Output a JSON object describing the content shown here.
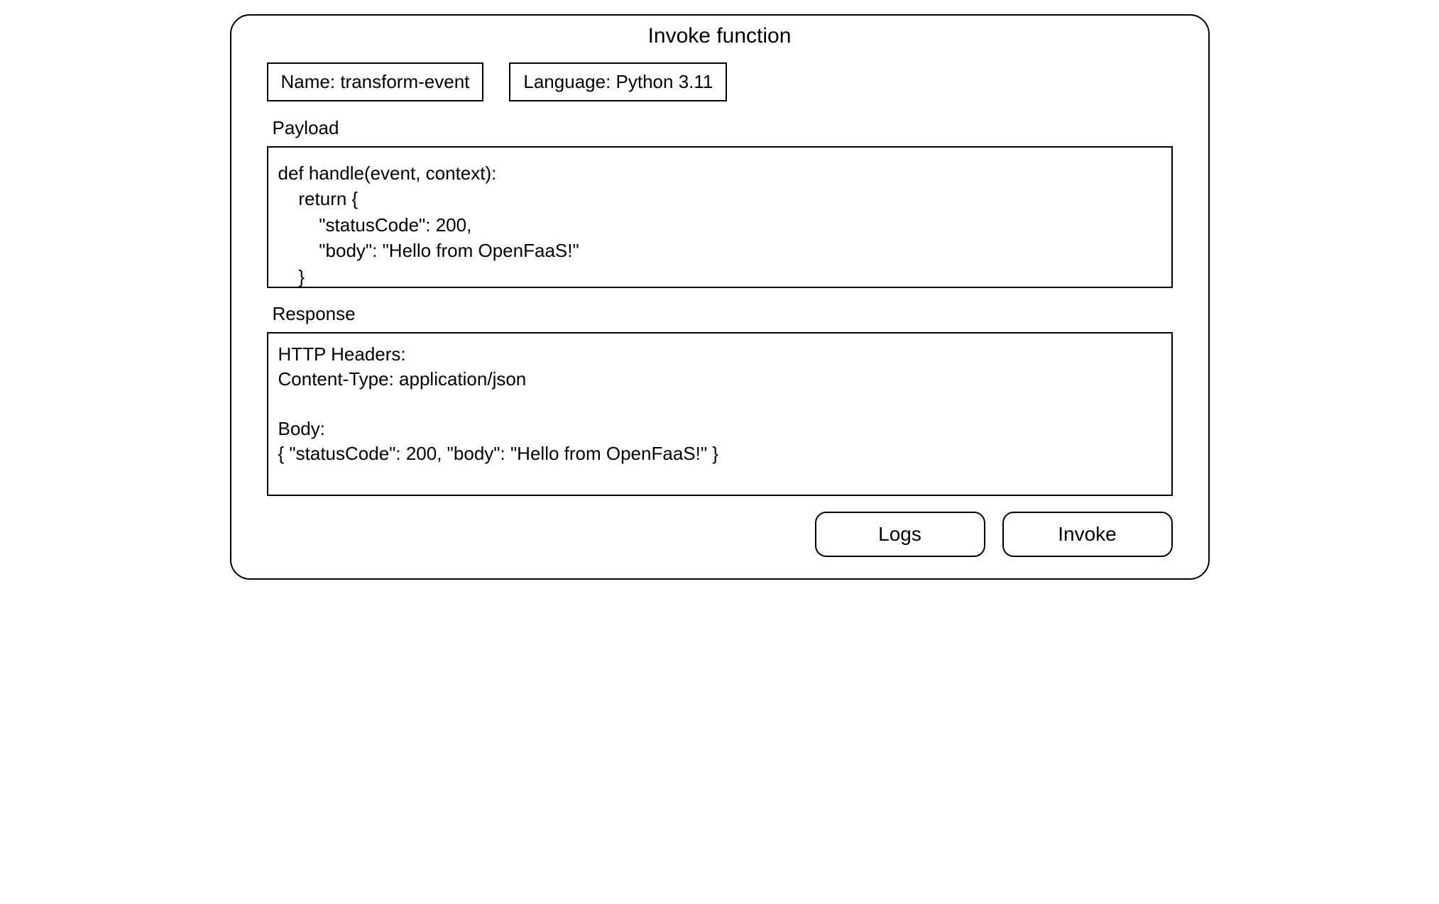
{
  "title": "Invoke function",
  "meta": {
    "name_label": "Name:",
    "name_value": "transform-event",
    "language_label": "Language:",
    "language_value": "Python 3.11"
  },
  "payload": {
    "label": "Payload",
    "content": "def handle(event, context):\n    return {\n        \"statusCode\": 200,\n        \"body\": \"Hello from OpenFaaS!\"\n    }"
  },
  "response": {
    "label": "Response",
    "content": "HTTP Headers:\nContent-Type: application/json\n\nBody:\n{ \"statusCode\": 200, \"body\": \"Hello from OpenFaaS!\" }"
  },
  "buttons": {
    "logs": "Logs",
    "invoke": "Invoke"
  }
}
